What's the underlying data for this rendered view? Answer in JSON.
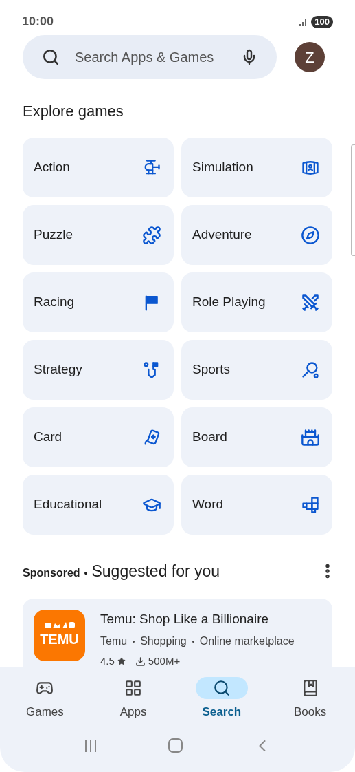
{
  "status_bar": {
    "time": "10:00",
    "battery": "100"
  },
  "search": {
    "placeholder": "Search Apps & Games",
    "avatar": "Z"
  },
  "explore": {
    "title": "Explore games",
    "categories": [
      {
        "label": "Action"
      },
      {
        "label": "Simulation"
      },
      {
        "label": "Puzzle"
      },
      {
        "label": "Adventure"
      },
      {
        "label": "Racing"
      },
      {
        "label": "Role Playing"
      },
      {
        "label": "Strategy"
      },
      {
        "label": "Sports"
      },
      {
        "label": "Card"
      },
      {
        "label": "Board"
      },
      {
        "label": "Educational"
      },
      {
        "label": "Word"
      }
    ]
  },
  "suggested": {
    "sponsored": "Sponsored",
    "separator": "•",
    "title": "Suggested for you",
    "apps": [
      {
        "logo_text": "TEMU",
        "name": "Temu: Shop Like a Billionaire",
        "tags": [
          "Temu",
          "Shopping",
          "Online marketplace"
        ],
        "rating": "4.5",
        "downloads": "500M+"
      }
    ]
  },
  "bottom_nav": [
    {
      "label": "Games",
      "selected": false
    },
    {
      "label": "Apps",
      "selected": false
    },
    {
      "label": "Search",
      "selected": true
    },
    {
      "label": "Books",
      "selected": false
    }
  ]
}
